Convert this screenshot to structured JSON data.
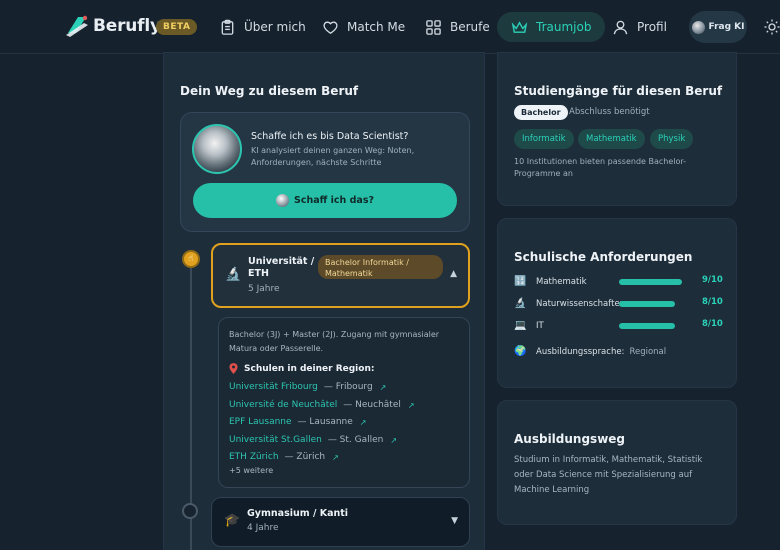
{
  "brand": {
    "name": "Berufly",
    "badge": "BETA"
  },
  "nav": {
    "items": [
      {
        "label": "Über mich",
        "icon": "clipboard-icon"
      },
      {
        "label": "Match Me",
        "icon": "heart-icon"
      },
      {
        "label": "Berufe",
        "icon": "grid-icon"
      },
      {
        "label": "Traumjob",
        "icon": "crown-icon",
        "active": true
      },
      {
        "label": "Profil",
        "icon": "user-icon"
      }
    ],
    "ki_button": "Frag KI",
    "theme_icon": "sun-icon"
  },
  "path_card": {
    "title": "Dein Weg zu diesem Beruf",
    "assistant": {
      "question": "Schaffe ich es bis Data Scientist?",
      "description": "KI analysiert deinen ganzen Weg: Noten, Anforderungen, nächste Schritte",
      "button": "Schaff ich das?"
    },
    "stages": [
      {
        "name": "Universität / ETH",
        "duration": "5 Jahre",
        "tag": "Bachelor Informatik / Mathematik",
        "icon": "microscope-icon",
        "expanded": true,
        "detail": {
          "description": "Bachelor (3J) + Master (2J). Zugang mit gymnasialer Matura oder Passerelle.",
          "schools_heading": "Schulen in deiner Region:",
          "schools": [
            {
              "name": "Universität Fribourg",
              "city": "— Fribourg"
            },
            {
              "name": "Université de Neuchâtel",
              "city": "— Neuchâtel"
            },
            {
              "name": "EPF Lausanne",
              "city": "— Lausanne"
            },
            {
              "name": "Universität St.Gallen",
              "city": "— St. Gallen"
            },
            {
              "name": "ETH Zürich",
              "city": "— Zürich"
            }
          ],
          "more": "+5 weitere"
        }
      },
      {
        "name": "Gymnasium / Kanti",
        "duration": "4 Jahre",
        "icon": "graduation-cap-icon",
        "expanded": false
      }
    ]
  },
  "study_card": {
    "title": "Studiengänge für diesen Beruf",
    "degree_chip": "Bachelor",
    "degree_note": "Abschluss benötigt",
    "subjects": [
      "Informatik",
      "Mathematik",
      "Physik"
    ],
    "note": "10 Institutionen bieten passende Bachelor-Programme an"
  },
  "school_req_card": {
    "title": "Schulische Anforderungen",
    "requirements": [
      {
        "subject": "Mathematik",
        "score": "9/10",
        "level": 0.9,
        "icon": "numbers-icon"
      },
      {
        "subject": "Naturwissenschaften",
        "score": "8/10",
        "level": 0.8,
        "icon": "microscope-icon"
      },
      {
        "subject": "IT",
        "score": "8/10",
        "level": 0.8,
        "icon": "laptop-icon"
      }
    ],
    "language_label": "Ausbildungssprache:",
    "language_value": "Regional"
  },
  "training_card": {
    "title": "Ausbildungsweg",
    "body": "Studium in Informatik, Mathematik, Statistik oder Data Science mit Spezialisierung auf Machine Learning"
  },
  "colors": {
    "accent": "#26bfa8",
    "highlight": "#e0a21e",
    "background": "#16222e"
  }
}
